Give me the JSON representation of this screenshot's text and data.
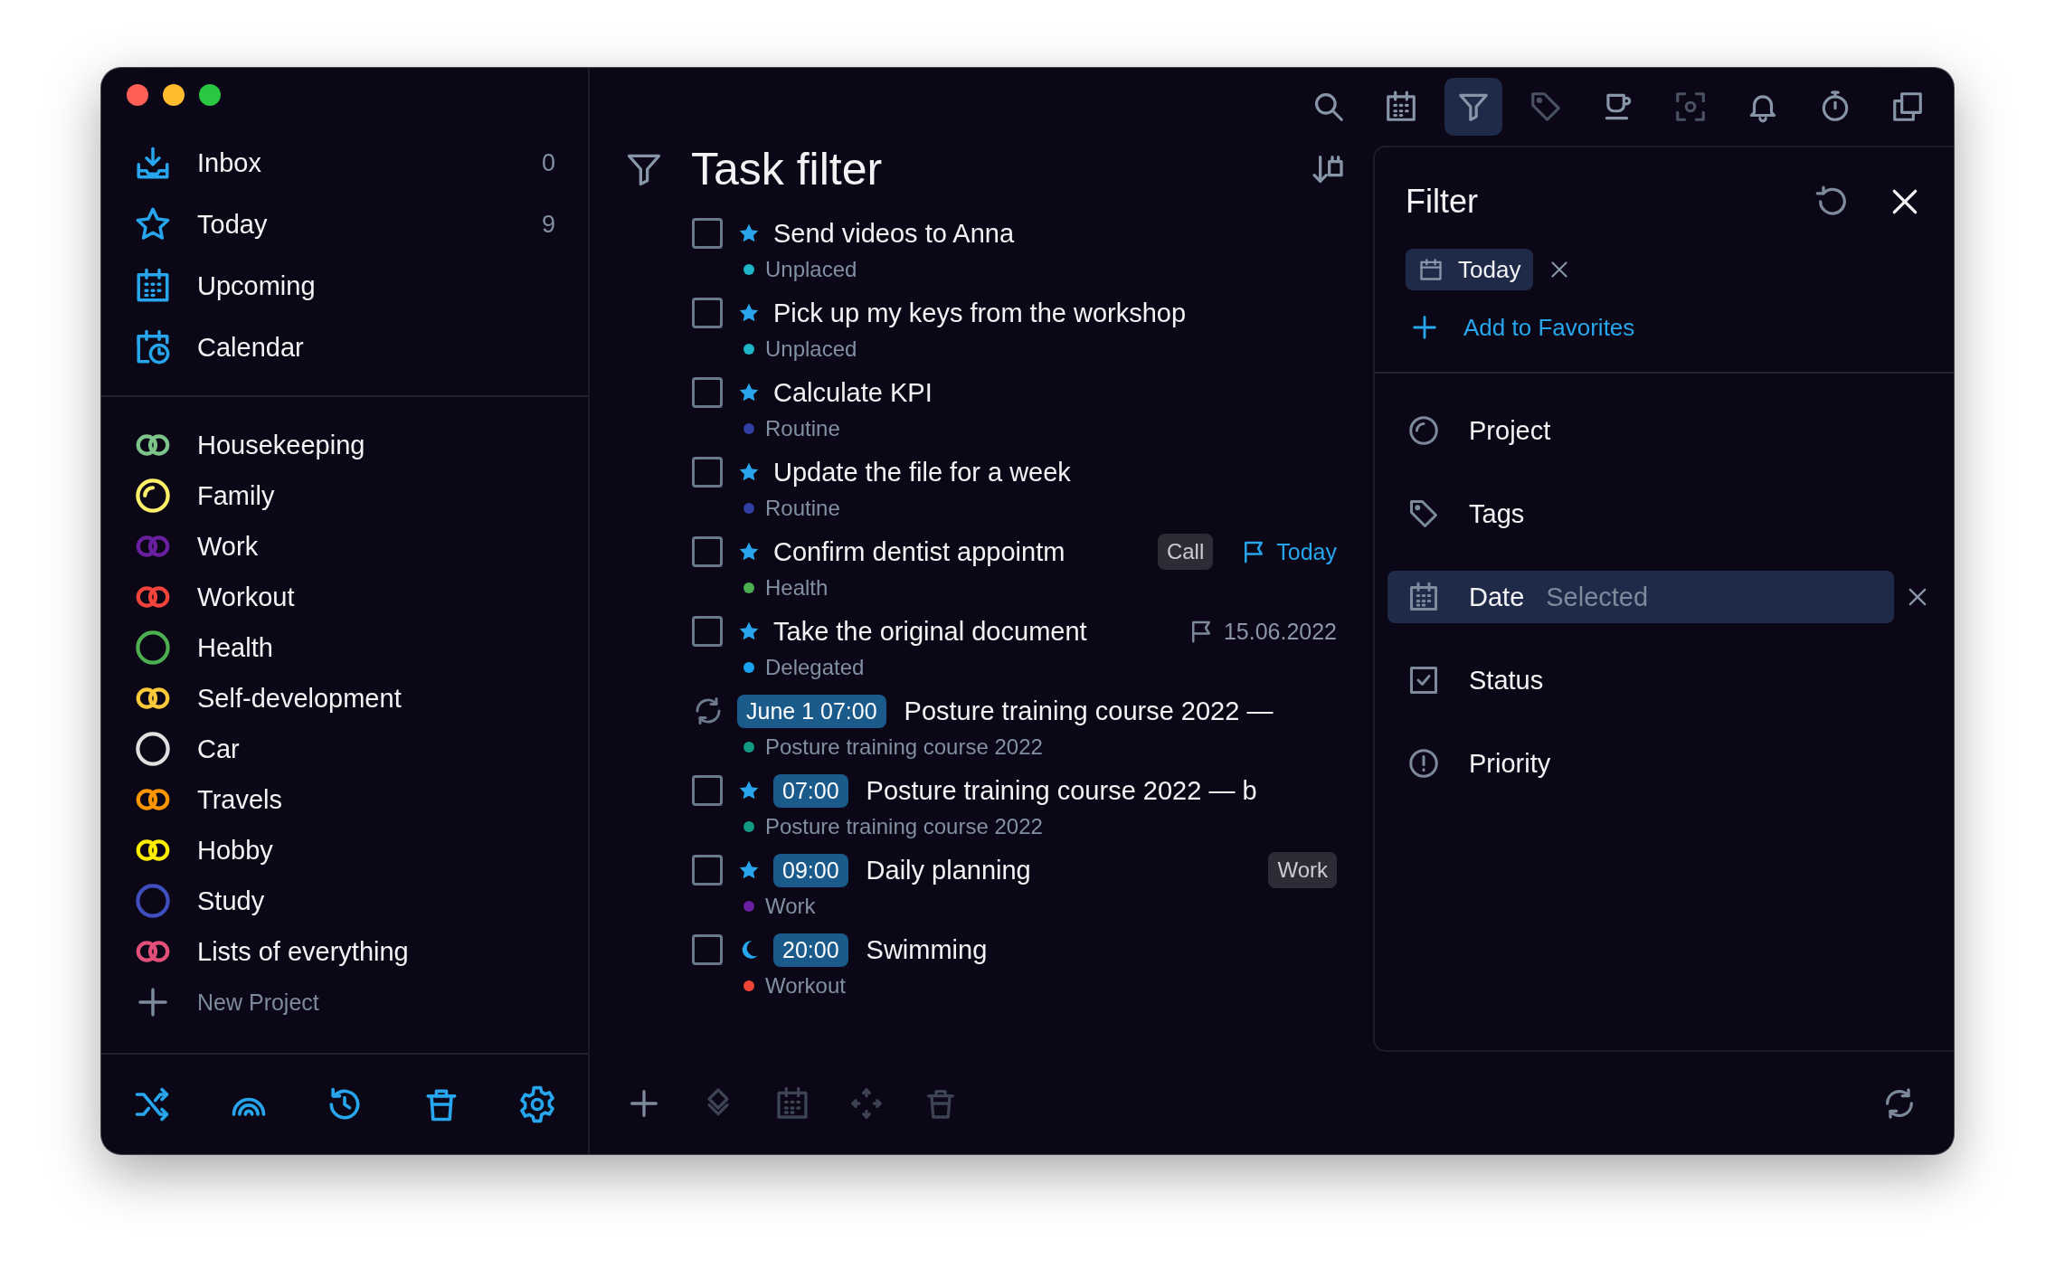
{
  "sidebar": {
    "nav": [
      {
        "kind": "inbox",
        "label": "Inbox",
        "count": "0"
      },
      {
        "kind": "today",
        "label": "Today",
        "count": "9"
      },
      {
        "kind": "upcoming",
        "label": "Upcoming"
      },
      {
        "kind": "calendar",
        "label": "Calendar"
      }
    ],
    "projects": [
      {
        "kind": "rings",
        "label": "Housekeeping",
        "color": "#7cc48a"
      },
      {
        "kind": "partial",
        "label": "Family",
        "color": "#fff06a"
      },
      {
        "kind": "rings",
        "label": "Work",
        "color": "#6a1fa0"
      },
      {
        "kind": "rings",
        "label": "Workout",
        "color": "#f0443a"
      },
      {
        "kind": "circle",
        "label": "Health",
        "color": "#4caf50"
      },
      {
        "kind": "rings",
        "label": "Self-development",
        "color": "#fcc93a"
      },
      {
        "kind": "circle",
        "label": "Car",
        "color": "#e0e0e0"
      },
      {
        "kind": "rings",
        "label": "Travels",
        "color": "#ff9500"
      },
      {
        "kind": "rings",
        "label": "Hobby",
        "color": "#ffee00"
      },
      {
        "kind": "circle",
        "label": "Study",
        "color": "#3f4fc0"
      },
      {
        "kind": "rings",
        "label": "Lists of everything",
        "color": "#e0507a"
      }
    ],
    "new_project": "New Project"
  },
  "toolbar": [
    {
      "kind": "search",
      "selected": false,
      "disabled": false
    },
    {
      "kind": "calendar",
      "selected": false,
      "disabled": false
    },
    {
      "kind": "filter",
      "selected": true,
      "disabled": false
    },
    {
      "kind": "tag",
      "selected": false,
      "disabled": true
    },
    {
      "kind": "cup",
      "selected": false,
      "disabled": false
    },
    {
      "kind": "focus",
      "selected": false,
      "disabled": true
    },
    {
      "kind": "bell",
      "selected": false,
      "disabled": false
    },
    {
      "kind": "timer",
      "selected": false,
      "disabled": false
    },
    {
      "kind": "copy",
      "selected": false,
      "disabled": false
    }
  ],
  "task_list": {
    "title": "Task filter",
    "tasks": [
      {
        "kind": "star",
        "checked": false,
        "title": "Send videos to Anna",
        "project": "Unplaced",
        "color": "#1fb6c9"
      },
      {
        "kind": "star",
        "checked": false,
        "title": "Pick up my keys from the workshop",
        "project": "Unplaced",
        "color": "#1fb6c9"
      },
      {
        "kind": "star",
        "checked": false,
        "title": "Calculate KPI",
        "project": "Routine",
        "color": "#2f3ea0"
      },
      {
        "kind": "star",
        "checked": false,
        "title": "Update the file for a week",
        "project": "Routine",
        "color": "#2f3ea0"
      },
      {
        "kind": "star",
        "checked": false,
        "title": "Confirm dentist appointm",
        "tag": "Call",
        "due": {
          "text": "Today",
          "highlighted": true
        },
        "project": "Health",
        "color": "#4caf50"
      },
      {
        "kind": "star",
        "checked": false,
        "title": "Take the original document",
        "due": {
          "text": "15.06.2022",
          "highlighted": false
        },
        "project": "Delegated",
        "color": "#1aa3f0"
      },
      {
        "kind": "recurring",
        "time": "June 1 07:00",
        "title": "Posture training course 2022 —",
        "project": "Posture training course 2022",
        "color": "#129a84"
      },
      {
        "kind": "star",
        "checked": false,
        "time": "07:00",
        "title": "Posture training course 2022 — b",
        "project": "Posture training course 2022",
        "color": "#129a84"
      },
      {
        "kind": "star",
        "checked": false,
        "time": "09:00",
        "title": "Daily planning",
        "tag": "Work",
        "project": "Work",
        "color": "#6a1fa0"
      },
      {
        "kind": "evening",
        "checked": false,
        "time": "20:00",
        "title": "Swimming",
        "project": "Workout",
        "color": "#f0443a"
      }
    ]
  },
  "filter": {
    "title": "Filter",
    "chip": "Today",
    "add_favorites": "Add to Favorites",
    "items": [
      {
        "kind": "project",
        "label": "Project",
        "selected": false
      },
      {
        "kind": "tags",
        "label": "Tags",
        "selected": false
      },
      {
        "kind": "date",
        "label": "Date",
        "value": "Selected",
        "selected": true
      },
      {
        "kind": "status",
        "label": "Status",
        "selected": false
      },
      {
        "kind": "priority",
        "label": "Priority",
        "selected": false
      }
    ]
  }
}
